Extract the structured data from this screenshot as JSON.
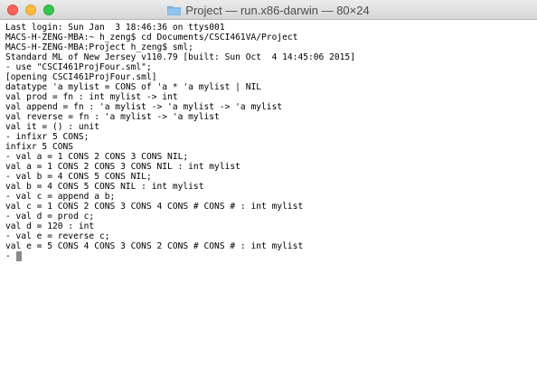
{
  "window": {
    "title": "Project — run.x86-darwin — 80×24"
  },
  "icons": {
    "close": "close-icon",
    "minimize": "minimize-icon",
    "zoom": "zoom-icon",
    "title_folder": "folder-icon"
  },
  "colors": {
    "close": "#fc615d",
    "minimize": "#fdbc40",
    "zoom": "#34c84a",
    "folder": "#79b8e8",
    "text": "#000000",
    "background": "#ffffff"
  },
  "terminal": {
    "lines": [
      "Last login: Sun Jan  3 18:46:36 on ttys001",
      "MACS-H-ZENG-MBA:~ h_zeng$ cd Documents/CSCI461VA/Project",
      "MACS-H-ZENG-MBA:Project h_zeng$ sml;",
      "Standard ML of New Jersey v110.79 [built: Sun Oct  4 14:45:06 2015]",
      "- use \"CSCI461ProjFour.sml\";",
      "[opening CSCI461ProjFour.sml]",
      "datatype 'a mylist = CONS of 'a * 'a mylist | NIL",
      "val prod = fn : int mylist -> int",
      "val append = fn : 'a mylist -> 'a mylist -> 'a mylist",
      "val reverse = fn : 'a mylist -> 'a mylist",
      "val it = () : unit",
      "- infixr 5 CONS;",
      "infixr 5 CONS",
      "- val a = 1 CONS 2 CONS 3 CONS NIL;",
      "val a = 1 CONS 2 CONS 3 CONS NIL : int mylist",
      "- val b = 4 CONS 5 CONS NIL;",
      "val b = 4 CONS 5 CONS NIL : int mylist",
      "- val c = append a b;",
      "val c = 1 CONS 2 CONS 3 CONS 4 CONS # CONS # : int mylist",
      "- val d = prod c;",
      "val d = 120 : int",
      "- val e = reverse c;",
      "val e = 5 CONS 4 CONS 3 CONS 2 CONS # CONS # : int mylist"
    ],
    "prompt": "- "
  }
}
